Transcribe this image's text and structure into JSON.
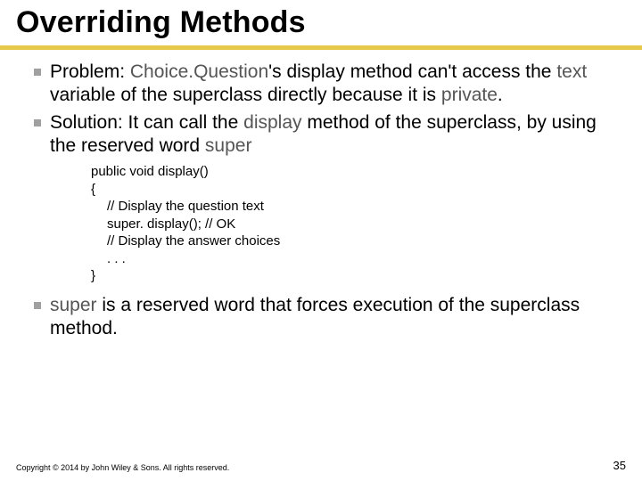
{
  "title": "Overriding Methods",
  "bullets": {
    "b1_problem_label": "Problem: ",
    "b1_cq": "Choice.Question",
    "b1_mid1": "'s display method can't access the ",
    "b1_text": "text",
    "b1_mid2": " variable of the superclass directly because it is ",
    "b1_private": "private",
    "b1_end": ".",
    "b2_solution_label": "Solution: It can call the ",
    "b2_display": "display",
    "b2_mid": " method of the superclass, by using the reserved word ",
    "b2_super": "super",
    "b3_pre": "",
    "b3_super": "super",
    "b3_post": " is a reserved word that forces execution of the superclass method."
  },
  "code": {
    "l1": "public void display()",
    "l2": "{",
    "l3": "// Display the question text",
    "l4": "super. display(); // OK",
    "l5": "// Display the answer choices",
    "l6": ". . .",
    "l7": "}"
  },
  "footer": {
    "copyright": "Copyright © 2014 by John Wiley & Sons. All rights reserved.",
    "page": "35"
  }
}
